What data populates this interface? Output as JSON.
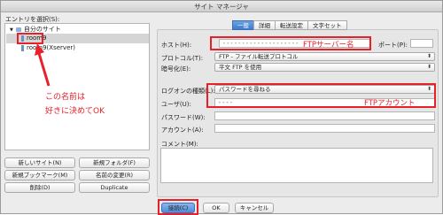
{
  "window": {
    "title": "サイト マネージャ"
  },
  "left": {
    "select_entry_label": "エントリを選択(S):",
    "tree": [
      {
        "label": "自分のサイト",
        "icon": "folder-icon"
      },
      {
        "label": "room9",
        "icon": "site-icon"
      },
      {
        "label": "room9(Xserver)",
        "icon": "site-icon"
      }
    ],
    "buttons": {
      "new_site": "新しいサイト(N)",
      "new_folder": "新規フォルダ(F)",
      "new_bookmark": "新規ブックマーク(M)",
      "rename": "名前の変更(R)",
      "delete": "削除(D)",
      "duplicate": "Duplicate"
    }
  },
  "tabs": [
    "一般",
    "詳細",
    "転送設定",
    "文字セット"
  ],
  "form": {
    "host_label": "ホスト(H):",
    "host_value": "••••••••••••••••••••",
    "port_label": "ポート(P):",
    "port_value": "",
    "protocol_label": "プロトコル(T):",
    "protocol_value": "FTP - ファイル転送プロトコル",
    "encryption_label": "暗号化(E):",
    "encryption_value": "平文 FTP を使用",
    "logon_type_label": "ログオンの種類(L):",
    "logon_type_value": "パスワードを尋ねる",
    "user_label": "ユーザ(U):",
    "user_value": "••••",
    "password_label": "パスワード(W):",
    "password_value": "",
    "account_label": "アカウント(A):",
    "account_value": "",
    "comment_label": "コメント(M):",
    "comment_value": ""
  },
  "annotations": {
    "host_note": "FTPサーバー名",
    "account_note": "FTPアカウント",
    "name_note_line1": "この名前は",
    "name_note_line2": "好きに決めてOK",
    "color": "#e8202a"
  },
  "bottom_buttons": {
    "connect": "接続(C)",
    "ok": "OK",
    "cancel": "キャンセル"
  }
}
